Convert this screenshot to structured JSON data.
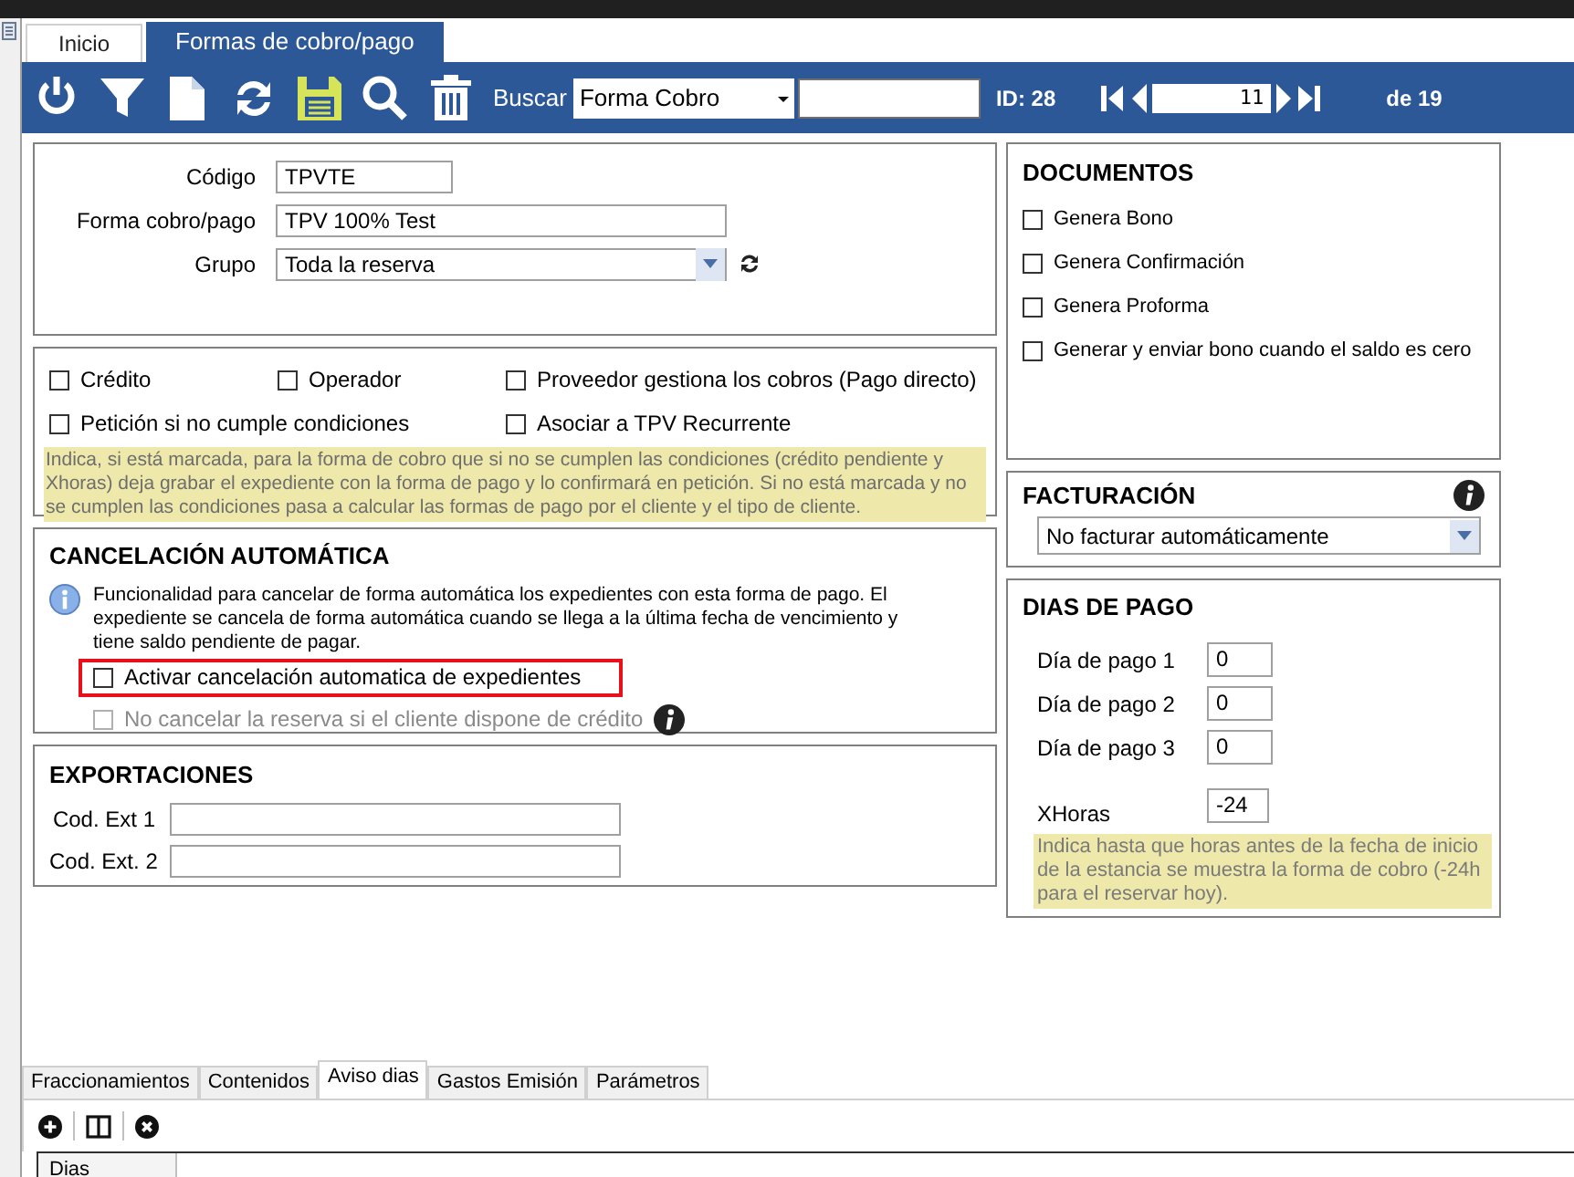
{
  "tabs": [
    {
      "label": "Inicio",
      "selected": false
    },
    {
      "label": "Formas de cobro/pago",
      "selected": true
    }
  ],
  "toolbar": {
    "search_label": "Buscar",
    "search_field": "Forma Cobro",
    "id_label": "ID: 28",
    "record": "11",
    "record_total": "de 19"
  },
  "general": {
    "fields": [
      {
        "label": "Código",
        "value": "TPVTE",
        "kind": "text"
      },
      {
        "label": "Forma cobro/pago",
        "value": "TPV 100% Test",
        "kind": "text"
      },
      {
        "label": "Grupo",
        "value": "Toda la reserva",
        "kind": "select"
      }
    ]
  },
  "options": {
    "checkboxes": [
      {
        "label": "Crédito",
        "checked": false
      },
      {
        "label": "Operador",
        "checked": false
      },
      {
        "label": "Proveedor gestiona los cobros (Pago directo)",
        "checked": false
      },
      {
        "label": "Petición si no cumple condiciones",
        "checked": false
      },
      {
        "label": "Asociar a TPV Recurrente",
        "checked": false
      }
    ],
    "note": "Indica, si está marcada, para la forma de cobro que si no se cumplen las condiciones (crédito pendiente y Xhoras) deja grabar el expediente con la forma de pago y lo confirmará en petición. Si no está marcada y no se cumplen las condiciones pasa a calcular las formas de pago por el cliente y el tipo de cliente."
  },
  "cancelacion": {
    "title": "CANCELACIÓN AUTOMÁTICA",
    "info": "Funcionalidad para cancelar de forma automática los expedientes con esta forma de pago. El expediente se cancela de forma automática cuando se llega a la última fecha de vencimiento y tiene saldo pendiente de pagar.",
    "checkboxes": [
      {
        "label": "Activar cancelación automatica de expedientes",
        "checked": false,
        "disabled": false,
        "highlighted": true
      },
      {
        "label": "No cancelar la reserva si el cliente dispone de crédito",
        "checked": false,
        "disabled": true,
        "highlighted": false
      }
    ]
  },
  "exportaciones": {
    "title": "EXPORTACIONES",
    "fields": [
      {
        "label": "Cod. Ext 1"
      },
      {
        "label": "Cod. Ext. 2"
      }
    ]
  },
  "documentos": {
    "title": "DOCUMENTOS",
    "checkboxes": [
      {
        "label": "Genera Bono",
        "checked": false
      },
      {
        "label": "Genera Confirmación",
        "checked": false
      },
      {
        "label": "Genera Proforma",
        "checked": false
      },
      {
        "label": "Generar y enviar bono cuando el saldo es cero",
        "checked": false
      }
    ]
  },
  "facturacion": {
    "title": "FACTURACIÓN",
    "select": "No facturar automáticamente"
  },
  "dias_de_pago": {
    "title": "DIAS DE PAGO",
    "fields": [
      {
        "label": "Día de pago 1",
        "value": "0"
      },
      {
        "label": "Día de pago 2",
        "value": "0"
      },
      {
        "label": "Día de pago 3",
        "value": "0"
      },
      {
        "label": "XHoras",
        "value": "-24"
      }
    ],
    "note": "Indica hasta que horas antes de la fecha de inicio de la estancia se muestra la forma de cobro (-24h para el reservar hoy)."
  },
  "bottom_tabs": [
    {
      "label": "Fraccionamientos",
      "selected": false
    },
    {
      "label": "Contenidos",
      "selected": false
    },
    {
      "label": "Aviso dias",
      "selected": true
    },
    {
      "label": "Gastos Emisión",
      "selected": false
    },
    {
      "label": "Parámetros",
      "selected": false
    }
  ],
  "grid": {
    "columns": [
      "Dias"
    ]
  }
}
